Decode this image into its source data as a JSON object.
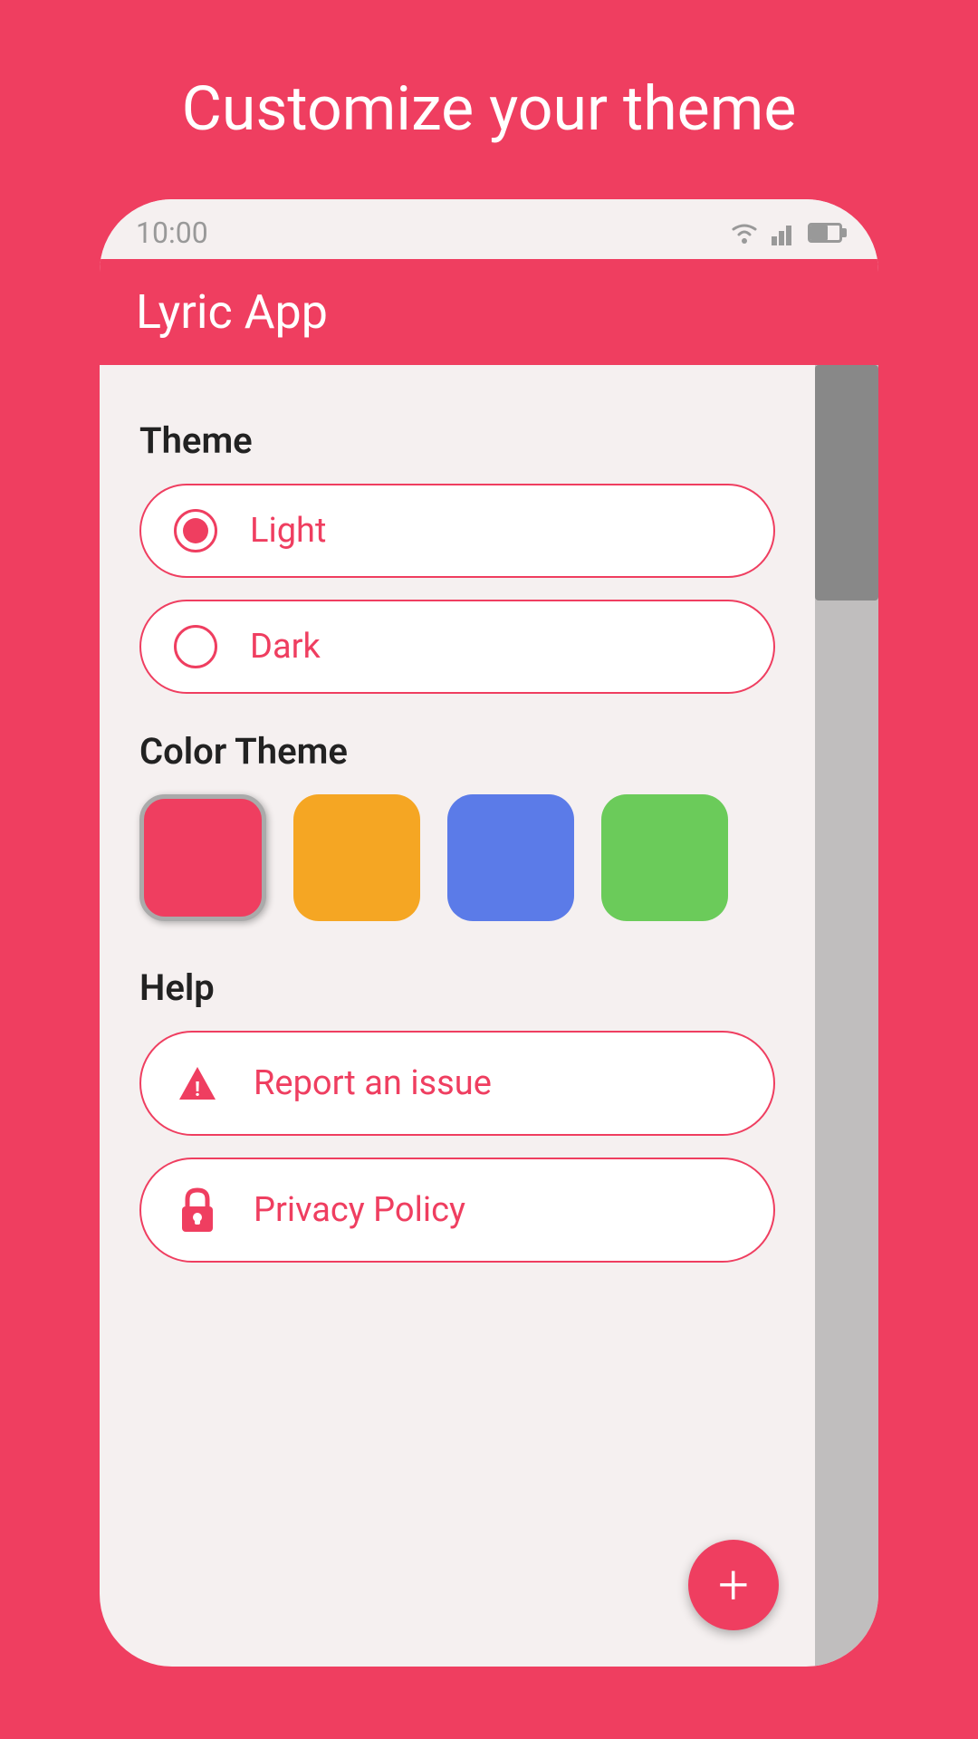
{
  "page": {
    "title": "Customize your theme",
    "background_color": "#EF3E60"
  },
  "status_bar": {
    "time": "10:00"
  },
  "app_bar": {
    "title": "Lyric App"
  },
  "theme_section": {
    "label": "Theme",
    "options": [
      {
        "id": "light",
        "label": "Light",
        "selected": true
      },
      {
        "id": "dark",
        "label": "Dark",
        "selected": false
      }
    ]
  },
  "color_theme_section": {
    "label": "Color Theme",
    "colors": [
      {
        "id": "red",
        "hex": "#EF3E60",
        "selected": true
      },
      {
        "id": "orange",
        "hex": "#F5A623",
        "selected": false
      },
      {
        "id": "blue",
        "hex": "#5B7BE8",
        "selected": false
      },
      {
        "id": "green",
        "hex": "#6BCB5A",
        "selected": false
      }
    ]
  },
  "help_section": {
    "label": "Help",
    "items": [
      {
        "id": "report-issue",
        "label": "Report an issue",
        "icon": "warning"
      },
      {
        "id": "privacy-policy",
        "label": "Privacy Policy",
        "icon": "lock"
      }
    ]
  },
  "fab": {
    "label": "+"
  }
}
